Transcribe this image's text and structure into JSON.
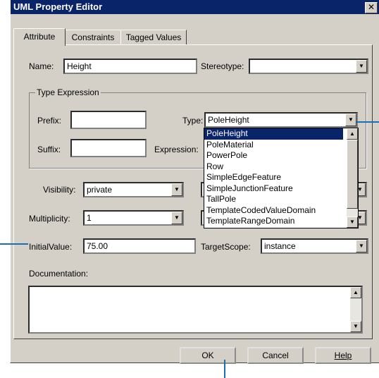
{
  "window": {
    "title": "UML Property Editor",
    "close_glyph": "✕"
  },
  "tabs": [
    {
      "label": "Attribute",
      "active": true
    },
    {
      "label": "Constraints",
      "active": false
    },
    {
      "label": "Tagged Values",
      "active": false
    }
  ],
  "name": {
    "label": "Name:",
    "value": "Height"
  },
  "stereotype": {
    "label": "Stereotype:",
    "value": ""
  },
  "type_expression": {
    "group_label": "Type Expression",
    "prefix": {
      "label": "Prefix:",
      "value": ""
    },
    "suffix": {
      "label": "Suffix:",
      "value": ""
    },
    "type": {
      "label": "Type:",
      "value": "PoleHeight"
    },
    "expression": {
      "label": "Expression:"
    }
  },
  "type_dropdown": {
    "options": [
      "PoleHeight",
      "PoleMaterial",
      "PowerPole",
      "Row",
      "SimpleEdgeFeature",
      "SimpleJunctionFeature",
      "TallPole",
      "TemplateCodedValueDomain",
      "TemplateRangeDomain"
    ],
    "selected": "PoleHeight"
  },
  "visibility": {
    "label": "Visibility:",
    "value": "private"
  },
  "multiplicity": {
    "label": "Multiplicity:",
    "value": "1"
  },
  "initial_value": {
    "label": "InitialValue:",
    "value": "75.00"
  },
  "target_scope": {
    "label": "TargetScope:",
    "value": "instance"
  },
  "documentation": {
    "label": "Documentation:",
    "value": ""
  },
  "buttons": {
    "ok": "OK",
    "cancel": "Cancel",
    "help": "Help"
  },
  "colors": {
    "title_bar": "#0a246a",
    "dialog_face": "#d4d0c8",
    "selection": "#0a246a",
    "callout_line": "#1a6fb0"
  },
  "icons": {
    "dropdown_arrow": "chevron-down-icon",
    "scroll_up": "scroll-up-icon",
    "scroll_down": "scroll-down-icon"
  }
}
